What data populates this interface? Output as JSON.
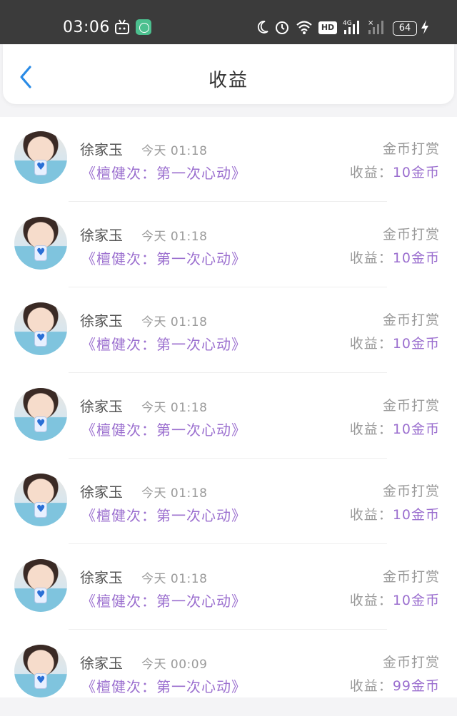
{
  "status_bar": {
    "time": "03:06",
    "hd_label": "HD",
    "network_label": "4G",
    "battery": "64"
  },
  "header": {
    "title": "收益",
    "back_icon": "chevron-left-icon",
    "accent_color": "#2a8be6"
  },
  "records": [
    {
      "user": "徐家玉",
      "time": "今天 01:18",
      "book": "《檀健次：第一次心动》",
      "type": "金币打赏",
      "income_label": "收益：",
      "income_amount": "10金币"
    },
    {
      "user": "徐家玉",
      "time": "今天 01:18",
      "book": "《檀健次：第一次心动》",
      "type": "金币打赏",
      "income_label": "收益：",
      "income_amount": "10金币"
    },
    {
      "user": "徐家玉",
      "time": "今天 01:18",
      "book": "《檀健次：第一次心动》",
      "type": "金币打赏",
      "income_label": "收益：",
      "income_amount": "10金币"
    },
    {
      "user": "徐家玉",
      "time": "今天 01:18",
      "book": "《檀健次：第一次心动》",
      "type": "金币打赏",
      "income_label": "收益：",
      "income_amount": "10金币"
    },
    {
      "user": "徐家玉",
      "time": "今天 01:18",
      "book": "《檀健次：第一次心动》",
      "type": "金币打赏",
      "income_label": "收益：",
      "income_amount": "10金币"
    },
    {
      "user": "徐家玉",
      "time": "今天 01:18",
      "book": "《檀健次：第一次心动》",
      "type": "金币打赏",
      "income_label": "收益：",
      "income_amount": "10金币"
    },
    {
      "user": "徐家玉",
      "time": "今天 00:09",
      "book": "《檀健次：第一次心动》",
      "type": "金币打赏",
      "income_label": "收益：",
      "income_amount": "99金币"
    }
  ]
}
